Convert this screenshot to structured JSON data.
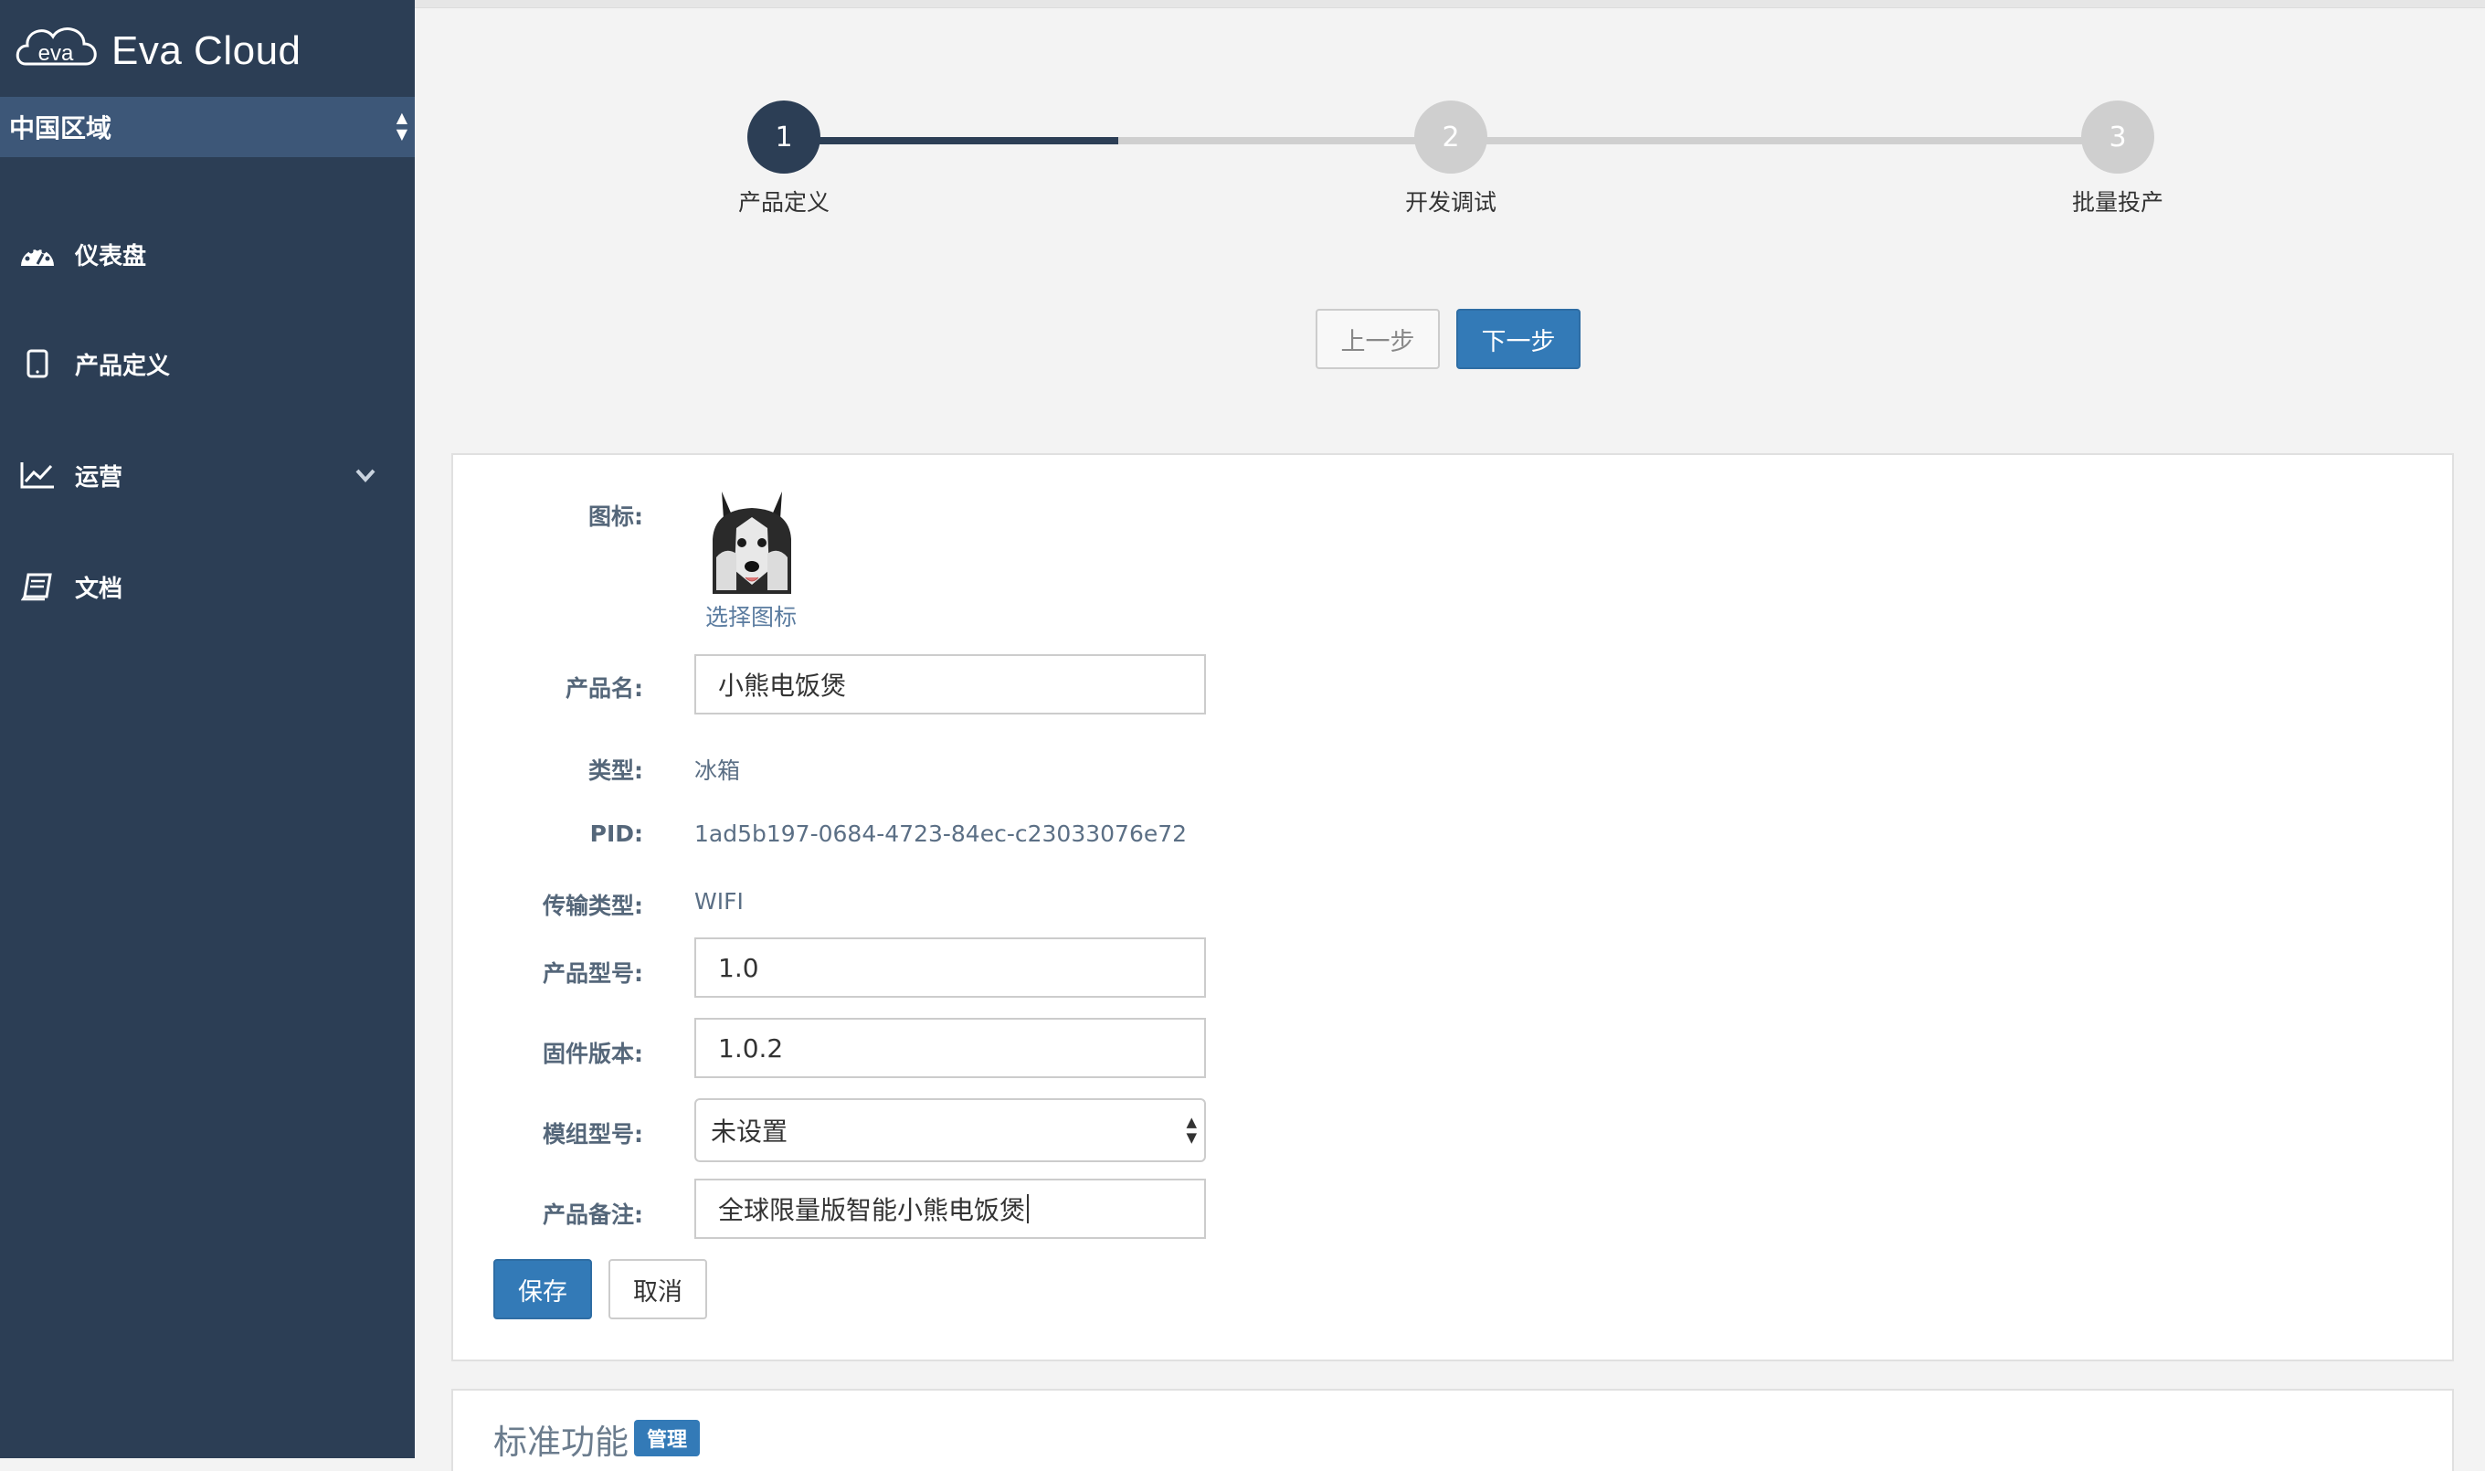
{
  "brand": {
    "name": "Eva Cloud",
    "logo": "eva-logo"
  },
  "region": {
    "label": "中国区域"
  },
  "sidebar": {
    "items": [
      {
        "label": "仪表盘",
        "icon": "dashboard-icon"
      },
      {
        "label": "产品定义",
        "icon": "tablet-icon"
      },
      {
        "label": "运营",
        "icon": "line-chart-icon",
        "expandable": true
      },
      {
        "label": "文档",
        "icon": "book-icon"
      }
    ]
  },
  "steps": [
    {
      "number": "1",
      "label": "产品定义",
      "state": "active"
    },
    {
      "number": "2",
      "label": "开发调试",
      "state": "todo"
    },
    {
      "number": "3",
      "label": "批量投产",
      "state": "todo"
    }
  ],
  "step_nav": {
    "prev": "上一步",
    "next": "下一步"
  },
  "form": {
    "icon": {
      "label": "图标:",
      "choose": "选择图标"
    },
    "product_name": {
      "label": "产品名:",
      "value": "小熊电饭煲"
    },
    "type": {
      "label": "类型:",
      "value": "冰箱"
    },
    "pid": {
      "label": "PID:",
      "value": "1ad5b197-0684-4723-84ec-c23033076e72"
    },
    "transport": {
      "label": "传输类型:",
      "value": "WIFI"
    },
    "model": {
      "label": "产品型号:",
      "value": "1.0"
    },
    "firmware": {
      "label": "固件版本:",
      "value": "1.0.2"
    },
    "module": {
      "label": "模组型号:",
      "value": "未设置"
    },
    "remark": {
      "label": "产品备注:",
      "value": "全球限量版智能小熊电饭煲"
    },
    "save": "保存",
    "cancel": "取消"
  },
  "standard": {
    "title": "标准功能",
    "badge": "管理"
  },
  "colors": {
    "sidebar": "#2c3e55",
    "region": "#3d5778",
    "primary": "#337ab7"
  }
}
